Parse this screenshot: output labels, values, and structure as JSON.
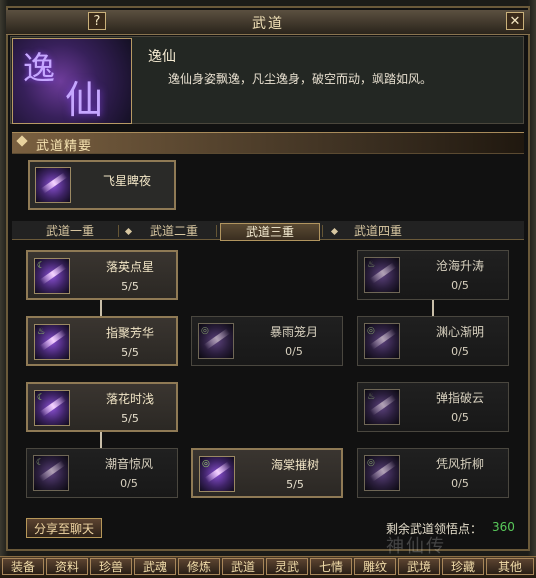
{
  "window": {
    "title": "武道",
    "help_label": "?",
    "close_label": "✕"
  },
  "header": {
    "skill_name": "逸仙",
    "description": "逸仙身姿飘逸，凡尘逸身，破空而动，飒踏如风。",
    "icon_text_1": "逸",
    "icon_text_2": "仙"
  },
  "essence": {
    "section_title": "武道精要",
    "skill_name": "飞星睥夜"
  },
  "tabs": [
    {
      "label": "武道一重",
      "active": false
    },
    {
      "label": "武道二重",
      "active": false
    },
    {
      "label": "武道三重",
      "active": true
    },
    {
      "label": "武道四重",
      "active": false
    }
  ],
  "nodes": {
    "n1": {
      "name": "落英点星",
      "count": "5/5"
    },
    "n2": {
      "name": "指聚芳华",
      "count": "5/5"
    },
    "n3": {
      "name": "落花时浅",
      "count": "5/5"
    },
    "n4": {
      "name": "潮音惊风",
      "count": "0/5"
    },
    "n5": {
      "name": "暴雨笼月",
      "count": "0/5"
    },
    "n6": {
      "name": "海棠摧树",
      "count": "5/5"
    },
    "n7": {
      "name": "沧海升涛",
      "count": "0/5"
    },
    "n8": {
      "name": "渊心渐明",
      "count": "0/5"
    },
    "n9": {
      "name": "弹指破云",
      "count": "0/5"
    },
    "n10": {
      "name": "凭风折柳",
      "count": "0/5"
    }
  },
  "footer": {
    "share_button": "分享至聊天",
    "points_label": "剩余武道领悟点：",
    "points_value": "360",
    "watermark": "神仙传"
  },
  "bottom_menu": [
    "装备",
    "资料",
    "珍兽",
    "武魂",
    "修炼",
    "武道",
    "灵武",
    "七情",
    "雕纹",
    "武境",
    "珍藏",
    "其他"
  ],
  "colors": {
    "accent": "#8f7a55",
    "points": "#58c85a",
    "icon_purple": "#7c42d8"
  }
}
